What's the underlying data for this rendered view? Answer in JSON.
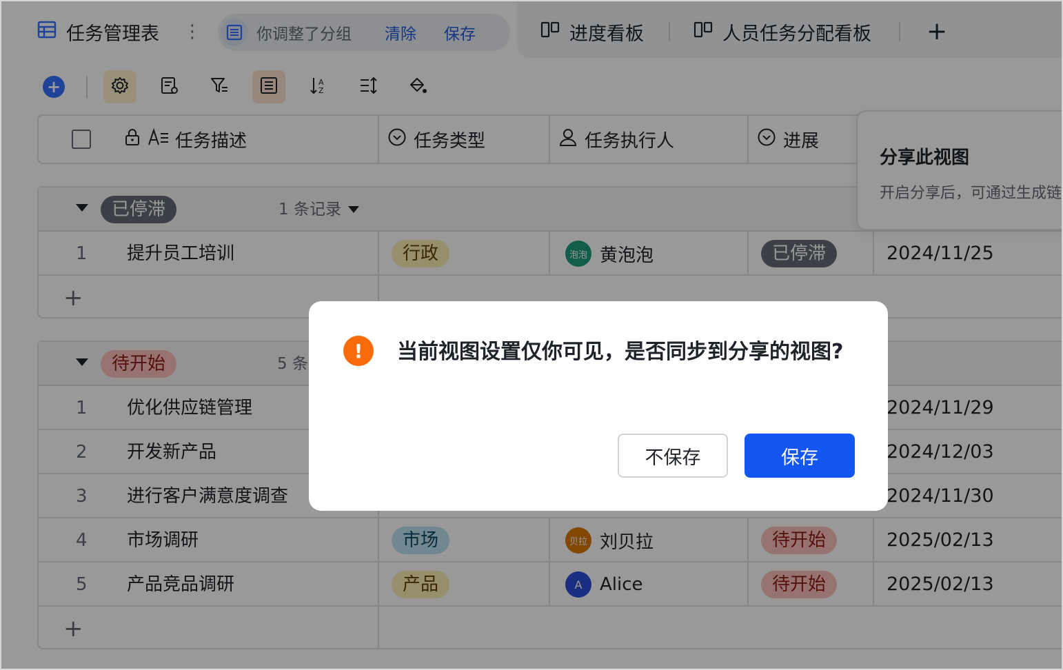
{
  "colors": {
    "accent": "#3370ff",
    "primary_button": "#1456f0",
    "warning": "#f76b0a",
    "stalled_pill": "#646a73",
    "todo_pill": "#fbbfbc"
  },
  "tabs": {
    "active": {
      "title": "任务管理表",
      "icon": "table-grid-icon"
    },
    "group_notice": {
      "text": "你调整了分组",
      "clear": "清除",
      "save": "保存"
    },
    "kanban_1": {
      "label": "进度看板",
      "icon": "kanban-icon"
    },
    "kanban_2": {
      "label": "人员任务分配看板",
      "icon": "kanban-icon"
    },
    "add": "+"
  },
  "toolbar": {
    "icons": [
      "add-icon",
      "gear-icon",
      "field-settings-icon",
      "filter-icon",
      "group-icon",
      "sort-icon",
      "row-height-icon",
      "fill-color-icon"
    ]
  },
  "columns": {
    "desc": "任务描述",
    "type": "任务类型",
    "assignee": "任务执行人",
    "progress": "进展"
  },
  "groups": [
    {
      "label": "已停滞",
      "count": "1 条记录",
      "rows": [
        {
          "num": "1",
          "desc": "提升员工培训",
          "type": "行政",
          "assignee": "黄泡泡",
          "avatar_text": "泡泡",
          "avatar_color": "#1f9b7a",
          "progress": "已停滞",
          "date": "2024/11/25"
        }
      ]
    },
    {
      "label": "待开始",
      "count": "5 条",
      "rows": [
        {
          "num": "1",
          "desc": "优化供应链管理",
          "date": "2024/11/29"
        },
        {
          "num": "2",
          "desc": "开发新产品",
          "date": "2024/12/03"
        },
        {
          "num": "3",
          "desc": "进行客户满意度调查",
          "date": "2024/11/30"
        },
        {
          "num": "4",
          "desc": "市场调研",
          "type": "市场",
          "assignee": "刘贝拉",
          "avatar_text": "贝拉",
          "avatar_color": "#d97706",
          "progress": "待开始",
          "date": "2025/02/13"
        },
        {
          "num": "5",
          "desc": "产品竞品调研",
          "type": "产品",
          "assignee": "Alice",
          "avatar_text": "A",
          "avatar_color": "#2e4fd6",
          "progress": "待开始",
          "date": "2025/02/13"
        }
      ]
    }
  ],
  "share_popover": {
    "title": "分享此视图",
    "desc": "开启分享后，可通过生成链"
  },
  "dialog": {
    "message": "当前视图设置仅你可见，是否同步到分享的视图?",
    "warn_glyph": "!",
    "cancel": "不保存",
    "save": "保存"
  }
}
